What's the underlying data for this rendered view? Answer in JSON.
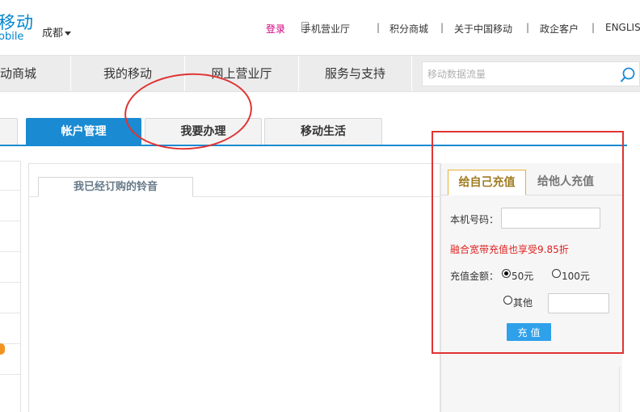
{
  "header": {
    "logo_cn": "移动",
    "logo_en": "obile",
    "city": "成都",
    "links": [
      "登录",
      "手机营业厅",
      "积分商城",
      "关于中国移动",
      "政企客户",
      "ENGLISH"
    ],
    "separator": "|"
  },
  "nav": {
    "items": [
      "动商城",
      "我的移动",
      "网上营业厅",
      "服务与支持"
    ],
    "search_placeholder": "移动数据流量"
  },
  "tabs": {
    "items": [
      "帐户管理",
      "我要办理",
      "移动生活"
    ],
    "active_index": 0
  },
  "main": {
    "sub_tab": "我已经订购的铃音"
  },
  "recharge": {
    "tabs": [
      "给自己充值",
      "给他人充值"
    ],
    "phone_label": "本机号码：",
    "phone_value": "",
    "promo": "融合宽带充值也享受9.85折",
    "amount_label": "充值金额：",
    "options": [
      "50元",
      "100元",
      "其他"
    ],
    "selected": "50元",
    "other_value": "",
    "submit_label": "充值"
  },
  "colors": {
    "brand_blue": "#0085d0",
    "tab_active": "#1a8ad2",
    "login_magenta": "#d1007e",
    "annotation_red": "#e03333",
    "promo_red": "#e02020",
    "button_blue": "#2fa0ea",
    "tab_gold": "#e8b038"
  },
  "icons": [
    "phone-icon",
    "search-icon",
    "chevron-down-icon"
  ]
}
